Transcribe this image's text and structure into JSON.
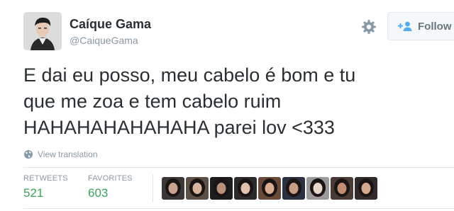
{
  "user": {
    "name": "Caíque Gama",
    "handle": "@CaiqueGama"
  },
  "actions": {
    "follow_label": "Follow"
  },
  "tweet": {
    "lines": [
      "E dai eu posso, meu cabelo é bom e tu",
      "que me zoa e tem cabelo ruim",
      "HAHAHAHAHAHAHA parei lov <333"
    ],
    "translate_label": "View translation"
  },
  "stats": {
    "retweets_label": "RETWEETS",
    "retweets_value": "521",
    "favorites_label": "FAVORITES",
    "favorites_value": "603"
  },
  "colors": {
    "stat_value": "#3aa35b",
    "follow_icon": "#55acee",
    "meta_text": "#8899a6"
  },
  "icons": {
    "settings": "gear-icon",
    "follow": "add-user-icon",
    "translate": "globe-icon"
  },
  "favoriter_avatars": [
    {
      "tone": "#3d3838",
      "skin": "#c9a38f"
    },
    {
      "tone": "#5a5048",
      "skin": "#d8b49e"
    },
    {
      "tone": "#1d1d1d",
      "skin": "#b8917b"
    },
    {
      "tone": "#2c2a2a",
      "skin": "#e0c2ad"
    },
    {
      "tone": "#6a4b3a",
      "skin": "#d9ad92"
    },
    {
      "tone": "#2b3140",
      "skin": "#c89b83"
    },
    {
      "tone": "#9a9a9a",
      "skin": "#e8d6cb"
    },
    {
      "tone": "#4a3a36",
      "skin": "#c08c72"
    },
    {
      "tone": "#332a2a",
      "skin": "#d4a88e"
    }
  ]
}
